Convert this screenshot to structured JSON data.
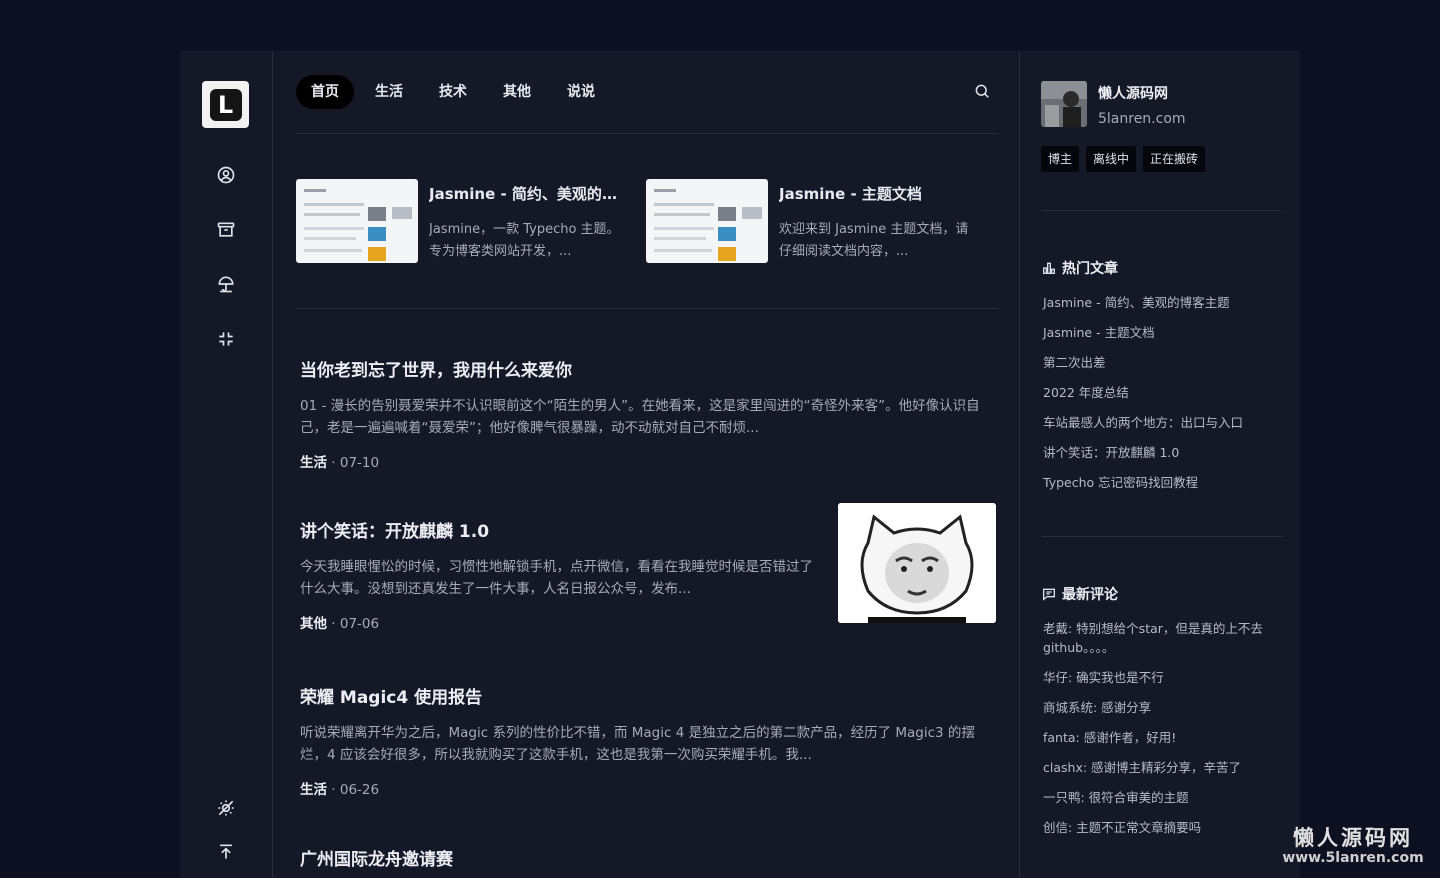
{
  "logo": {
    "letter": "L"
  },
  "rail": {
    "icons": [
      "user-circle-icon",
      "archive-icon",
      "umbrella-icon",
      "fullscreen-icon",
      "theme-toggle-icon",
      "back-to-top-icon"
    ]
  },
  "nav": {
    "items": [
      {
        "label": "首页",
        "active": true
      },
      {
        "label": "生活",
        "active": false
      },
      {
        "label": "技术",
        "active": false
      },
      {
        "label": "其他",
        "active": false
      },
      {
        "label": "说说",
        "active": false
      }
    ]
  },
  "featured": [
    {
      "title": "Jasmine - 简约、美观的博客主题",
      "desc": "Jasmine，一款 Typecho 主题。专为博客类网站开发，..."
    },
    {
      "title": "Jasmine - 主题文档",
      "desc": "欢迎来到 Jasmine 主题文档，请仔细阅读文档内容，..."
    }
  ],
  "posts": [
    {
      "title": "当你老到忘了世界，我用什么来爱你",
      "excerpt": "01 - 漫长的告别聂爱荣并不认识眼前这个“陌生的男人”。在她看来，这是家里闯进的“奇怪外来客”。他好像认识自己，老是一遍遍喊着“聂爱荣”；他好像脾气很暴躁，动不动就对自己不耐烦...",
      "category": "生活",
      "date": " · 07-10"
    },
    {
      "title": "讲个笑话：开放麒麟 1.0",
      "excerpt": "今天我睡眼惺忪的时候，习惯性地解锁手机，点开微信，看看在我睡觉时候是否错过了什么大事。没想到还真发生了一件大事，人名日报公众号，发布...",
      "category": "其他",
      "date": " · 07-06"
    },
    {
      "title": "荣耀 Magic4 使用报告",
      "excerpt": "听说荣耀离开华为之后，Magic 系列的性价比不错，而 Magic 4 是独立之后的第二款产品，经历了 Magic3 的摆烂，4 应该会好很多，所以我就购买了这款手机，这也是我第一次购买荣耀手机。我...",
      "category": "生活",
      "date": " · 06-26"
    },
    {
      "title": "广州国际龙舟邀请赛"
    }
  ],
  "profile": {
    "name": "懒人源码网",
    "url": "5lanren.com",
    "badges": [
      "博主",
      "离线中",
      "正在搬砖"
    ]
  },
  "hot": {
    "title": "热门文章",
    "items": [
      "Jasmine - 简约、美观的博客主题",
      "Jasmine - 主题文档",
      "第二次出差",
      "2022 年度总结",
      "车站最感人的两个地方：出口与入口",
      "讲个笑话：开放麒麟 1.0",
      "Typecho 忘记密码找回教程"
    ]
  },
  "comments": {
    "title": "最新评论",
    "items": [
      "老戴: 特别想给个star，但是真的上不去github。。。。",
      "华仔: 确实我也是不行",
      "商城系统: 感谢分享",
      "fanta: 感谢作者，好用!",
      "clashx: 感谢博主精彩分享，辛苦了",
      "一只鸭: 很符合审美的主题",
      "创信: 主题不正常文章摘要吗"
    ]
  },
  "watermark": {
    "line1": "懒人源码网",
    "line2": "www.5lanren.com"
  }
}
